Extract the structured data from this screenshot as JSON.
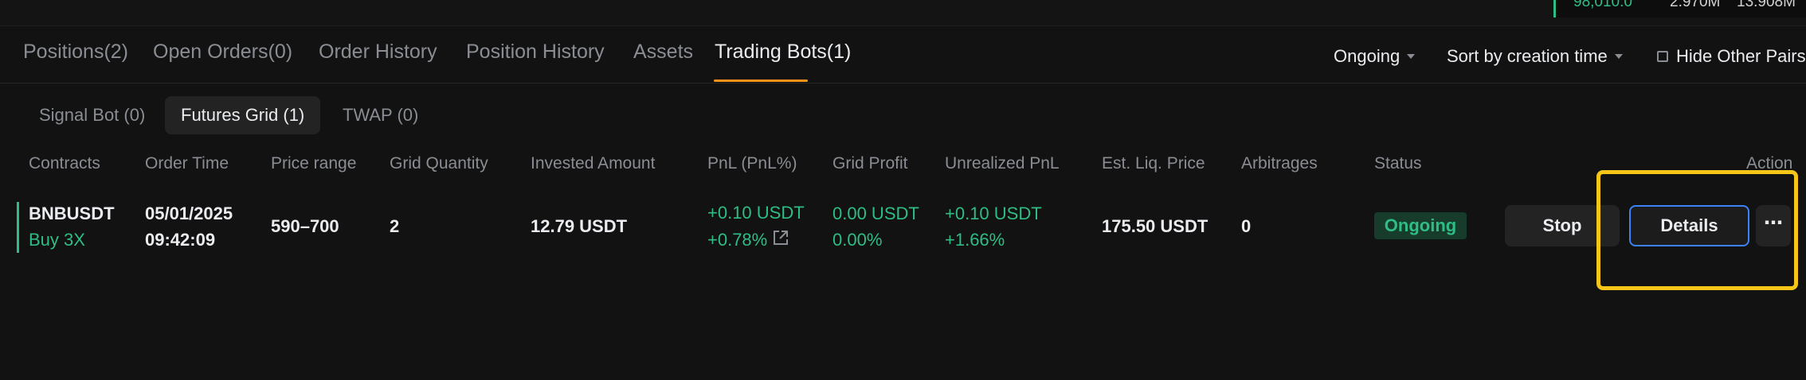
{
  "ticker": {
    "price": "98,010.0",
    "vol1": "2.970M",
    "vol2": "13.908M"
  },
  "tabs": [
    {
      "label": "Positions(2)"
    },
    {
      "label": "Open Orders(0)"
    },
    {
      "label": "Order History"
    },
    {
      "label": "Position History"
    },
    {
      "label": "Assets"
    },
    {
      "label": "Trading Bots(1)",
      "active": true
    }
  ],
  "controls": {
    "status_filter": "Ongoing",
    "sort": "Sort by creation time",
    "hide_other_pairs": "Hide Other Pairs",
    "hide_other_pairs_checked": false
  },
  "subtabs": [
    {
      "label": "Signal Bot (0)"
    },
    {
      "label": "Futures Grid (1)",
      "active": true
    },
    {
      "label": "TWAP (0)"
    }
  ],
  "columns": [
    "Contracts",
    "Order Time",
    "Price range",
    "Grid Quantity",
    "Invested Amount",
    "PnL (PnL%)",
    "Grid Profit",
    "Unrealized PnL",
    "Est. Liq. Price",
    "Arbitrages",
    "Status",
    "Action"
  ],
  "row": {
    "symbol": "BNBUSDT",
    "side": "Buy 3X",
    "date": "05/01/2025",
    "time": "09:42:09",
    "price_range": "590–700",
    "grid_qty": "2",
    "invested": "12.79 USDT",
    "pnl": "+0.10 USDT",
    "pnl_pct": "+0.78%",
    "grid_profit": "0.00 USDT",
    "grid_profit_pct": "0.00%",
    "unrealized": "+0.10 USDT",
    "unrealized_pct": "+1.66%",
    "liq_price": "175.50 USDT",
    "arbitrages": "0",
    "status": "Ongoing"
  },
  "actions": {
    "stop": "Stop",
    "details": "Details",
    "more": "⋯"
  },
  "colors": {
    "accent": "#f7931a",
    "positive": "#2ebd85",
    "highlight": "#f5c518",
    "focus": "#3b82f6"
  },
  "icons": {
    "pnl_share": "share-icon",
    "more": "more-icon"
  }
}
